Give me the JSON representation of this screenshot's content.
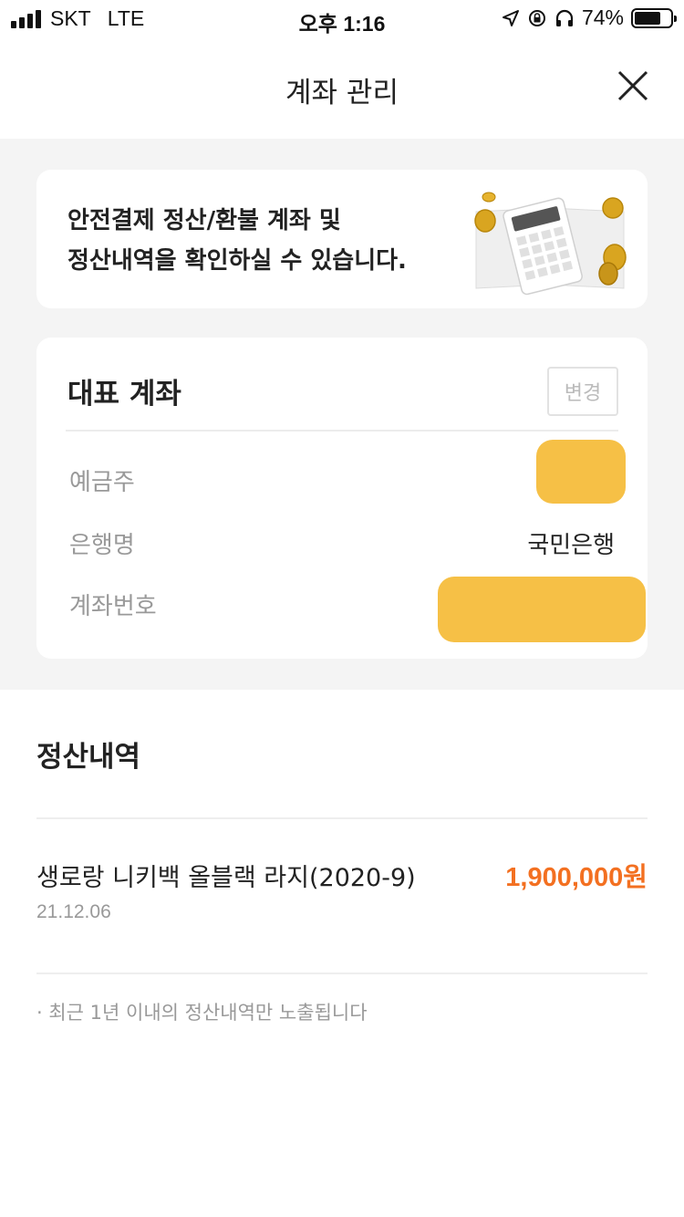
{
  "status_bar": {
    "carrier": "SKT",
    "network": "LTE",
    "time": "오후 1:16",
    "battery": "74%",
    "battery_level": 0.74
  },
  "header": {
    "title": "계좌 관리",
    "close_icon": "close-icon"
  },
  "info_banner": {
    "line1": "안전결제 정산/환불 계좌 및",
    "line2": "정산내역을 확인하실 수 있습니다.",
    "illustration": "calculator-coins-illustration"
  },
  "account": {
    "title": "대표 계좌",
    "change_label": "변경",
    "rows": [
      {
        "label": "예금주",
        "value": ""
      },
      {
        "label": "은행명",
        "value": "국민은행"
      },
      {
        "label": "계좌번호",
        "value": ""
      }
    ]
  },
  "settlement": {
    "title": "정산내역",
    "items": [
      {
        "name": "생로랑 니키백 올블랙 라지(2020-9)",
        "date": "21.12.06",
        "amount": "1,900,000원"
      }
    ],
    "notice": "· 최근 1년 이내의 정산내역만 노출됩니다"
  },
  "colors": {
    "accent": "#f37021",
    "background_grey": "#f4f4f4",
    "redaction": "#f5bd3c"
  }
}
